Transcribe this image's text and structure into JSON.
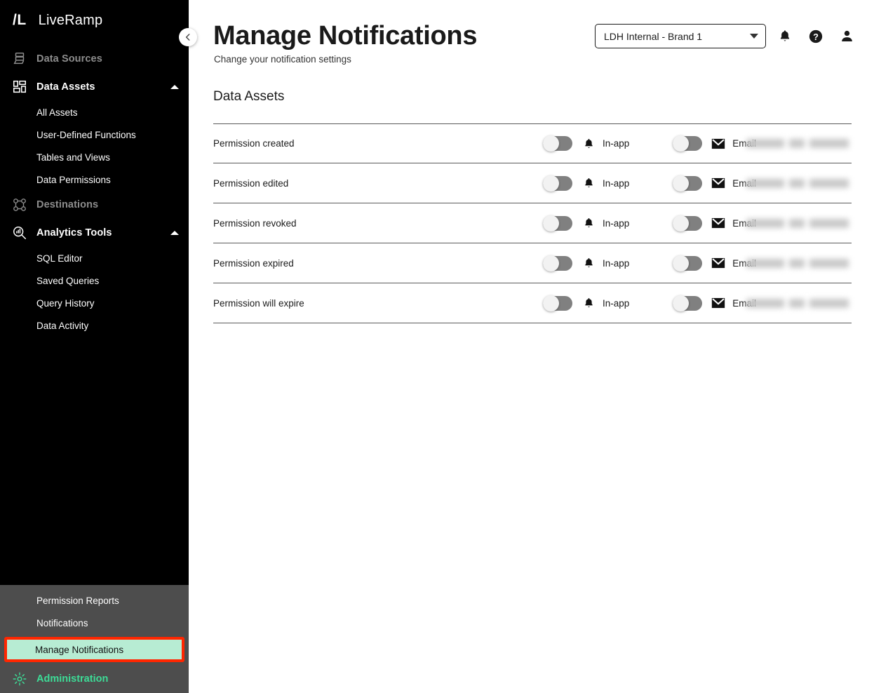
{
  "brand": {
    "mark": "/L",
    "name": "LiveRamp"
  },
  "sidebar": {
    "collapse_icon": "chevron-left-icon",
    "items": [
      {
        "label": "Data Sources",
        "icon": "data-sources-icon",
        "state": "muted",
        "expandable": false
      },
      {
        "label": "Data Assets",
        "icon": "data-assets-icon",
        "state": "active",
        "expandable": true,
        "expanded": true,
        "children": [
          {
            "label": "All Assets"
          },
          {
            "label": "User-Defined Functions"
          },
          {
            "label": "Tables and Views"
          },
          {
            "label": "Data Permissions"
          }
        ]
      },
      {
        "label": "Destinations",
        "icon": "destinations-icon",
        "state": "muted",
        "expandable": false
      },
      {
        "label": "Analytics Tools",
        "icon": "analytics-tools-icon",
        "state": "active",
        "expandable": true,
        "expanded": true,
        "children": [
          {
            "label": "SQL Editor"
          },
          {
            "label": "Saved Queries"
          },
          {
            "label": "Query History"
          },
          {
            "label": "Data Activity"
          }
        ]
      }
    ],
    "bottom": {
      "children": [
        {
          "label": "Permission Reports",
          "highlighted": false
        },
        {
          "label": "Notifications",
          "highlighted": false
        },
        {
          "label": "Manage Notifications",
          "highlighted": true
        }
      ],
      "admin": {
        "label": "Administration",
        "icon": "gear-icon",
        "expanded": true
      }
    }
  },
  "header": {
    "title": "Manage Notifications",
    "subtitle": "Change your notification settings",
    "brand_select": {
      "value": "LDH Internal - Brand 1",
      "caret_icon": "chevron-down-icon"
    },
    "icons": [
      {
        "name": "bell-icon",
        "label": "Notifications"
      },
      {
        "name": "help-icon",
        "label": "Help"
      },
      {
        "name": "user-icon",
        "label": "Account"
      }
    ]
  },
  "main": {
    "section_title": "Data Assets",
    "channels": {
      "inapp": {
        "label": "In-app",
        "icon": "bell-icon"
      },
      "email": {
        "label": "Email",
        "icon": "envelope-icon"
      }
    },
    "rows": [
      {
        "label": "Permission created",
        "inapp_on": false,
        "email_on": false,
        "redacted": true
      },
      {
        "label": "Permission edited",
        "inapp_on": false,
        "email_on": false,
        "redacted": true
      },
      {
        "label": "Permission revoked",
        "inapp_on": false,
        "email_on": false,
        "redacted": true
      },
      {
        "label": "Permission expired",
        "inapp_on": false,
        "email_on": false,
        "redacted": true
      },
      {
        "label": "Permission will expire",
        "inapp_on": false,
        "email_on": false,
        "redacted": true
      }
    ]
  },
  "colors": {
    "sidebar_bg": "#000000",
    "sidebar_bottom_bg": "#4d4d4d",
    "accent_green": "#3ddc97",
    "highlight_border": "#ff2600",
    "highlight_fill": "#b7ecd3",
    "toggle_off_track": "#808080"
  }
}
